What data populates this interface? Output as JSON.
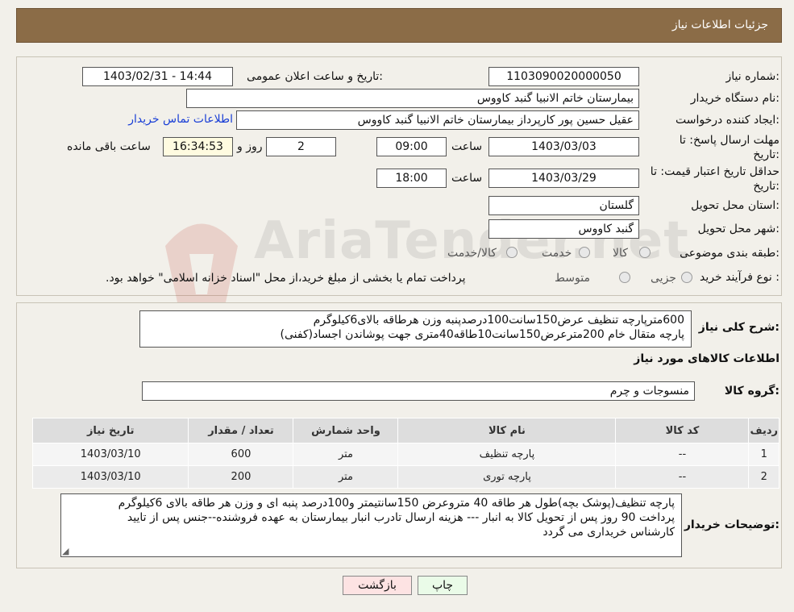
{
  "header": {
    "title": "جزئیات اطلاعات نیاز"
  },
  "form": {
    "need_number_label": "شماره نیاز:",
    "need_number": "1103090020000050",
    "announce_label": "تاریخ و ساعت اعلان عمومی:",
    "announce_value": "1403/02/31 - 14:44",
    "buyer_org_label": "نام دستگاه خریدار:",
    "buyer_org": "بیمارستان خاتم الانبیا گنبد کاووس",
    "creator_label": "ایجاد کننده درخواست:",
    "creator": "عقیل حسین پور کارپرداز بیمارستان خاتم الانبیا گنبد کاووس",
    "contact_link": "اطلاعات تماس خریدار",
    "deadline_label_1": "مهلت ارسال پاسخ: تا",
    "deadline_label_2": "تاریخ:",
    "deadline_date": "1403/03/03",
    "time_label": "ساعت",
    "deadline_time": "09:00",
    "days_value": "2",
    "days_label": "روز و",
    "remaining_time": "16:34:53",
    "remaining_label": "ساعت باقی مانده",
    "validity_label_1": "حداقل تاریخ اعتبار قیمت: تا",
    "validity_label_2": "تاریخ:",
    "validity_date": "1403/03/29",
    "validity_time": "18:00",
    "province_label": "استان محل تحویل:",
    "province": "گلستان",
    "city_label": "شهر محل تحویل:",
    "city": "گنبد کاووس",
    "category_label": "طبقه بندی موضوعی:",
    "category_options": [
      "کالا",
      "خدمت",
      "کالا/خدمت"
    ],
    "process_label": "نوع فرآیند خرید :",
    "process_options": [
      "جزیی",
      "متوسط"
    ],
    "process_note": "پرداخت تمام یا بخشی از مبلغ خرید،از محل \"اسناد خزانه اسلامی\" خواهد بود."
  },
  "summary": {
    "label": "شرح کلی نیاز:",
    "line1": "600مترپارچه تنظیف عرض150سانت100درصدپنبه وزن هرطاقه بالای6کیلوگرم",
    "line2": "پارچه متقال خام 200مترعرض150سانت10طاقه40متری جهت پوشاندن اجساد(کفنی)"
  },
  "goods_info": {
    "title": "اطلاعات کالاهای مورد نیاز",
    "group_label": "گروه کالا:",
    "group_value": "منسوجات و چرم"
  },
  "table": {
    "headers": [
      "ردیف",
      "کد کالا",
      "نام کالا",
      "واحد شمارش",
      "تعداد / مقدار",
      "تاریخ نیاز"
    ],
    "rows": [
      [
        "1",
        "--",
        "پارچه تنظیف",
        "متر",
        "600",
        "1403/03/10"
      ],
      [
        "2",
        "--",
        "پارچه توری",
        "متر",
        "200",
        "1403/03/10"
      ]
    ]
  },
  "notes": {
    "label": "توضیحات خریدار:",
    "line1": "پارچه تنظیف(پوشک بچه)طول هر طاقه 40 متروعرض 150سانتیمتر و100درصد پنبه ای و وزن هر طاقه بالای 6کیلوگرم",
    "line2": "پرداخت 90 روز پس از تحویل کالا به انبار --- هزینه ارسال تادرب انبار بیمارستان به عهده فروشنده--جنس پس از تایید",
    "line3": "کارشناس خریداری می گردد"
  },
  "buttons": {
    "print": "چاپ",
    "back": "بازگشت"
  },
  "watermark": "AriaTender.net",
  "colors": {
    "header_bg": "#8b6c47",
    "link": "#1a3fd6",
    "back_btn_bg": "#fde3e3",
    "print_btn_bg": "#eafbe8"
  }
}
